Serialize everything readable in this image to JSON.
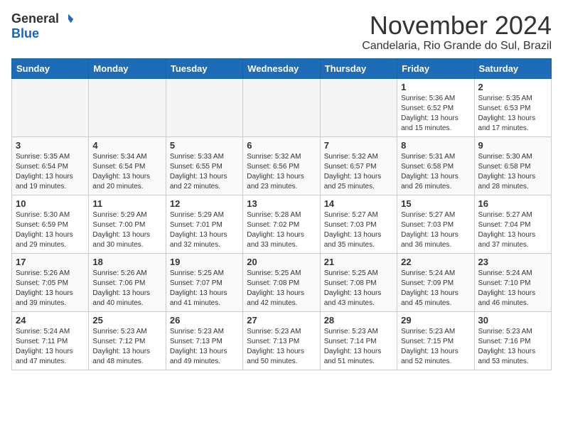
{
  "logo": {
    "general": "General",
    "blue": "Blue"
  },
  "header": {
    "month": "November 2024",
    "location": "Candelaria, Rio Grande do Sul, Brazil"
  },
  "weekdays": [
    "Sunday",
    "Monday",
    "Tuesday",
    "Wednesday",
    "Thursday",
    "Friday",
    "Saturday"
  ],
  "weeks": [
    [
      {
        "day": "",
        "info": ""
      },
      {
        "day": "",
        "info": ""
      },
      {
        "day": "",
        "info": ""
      },
      {
        "day": "",
        "info": ""
      },
      {
        "day": "",
        "info": ""
      },
      {
        "day": "1",
        "info": "Sunrise: 5:36 AM\nSunset: 6:52 PM\nDaylight: 13 hours and 15 minutes."
      },
      {
        "day": "2",
        "info": "Sunrise: 5:35 AM\nSunset: 6:53 PM\nDaylight: 13 hours and 17 minutes."
      }
    ],
    [
      {
        "day": "3",
        "info": "Sunrise: 5:35 AM\nSunset: 6:54 PM\nDaylight: 13 hours and 19 minutes."
      },
      {
        "day": "4",
        "info": "Sunrise: 5:34 AM\nSunset: 6:54 PM\nDaylight: 13 hours and 20 minutes."
      },
      {
        "day": "5",
        "info": "Sunrise: 5:33 AM\nSunset: 6:55 PM\nDaylight: 13 hours and 22 minutes."
      },
      {
        "day": "6",
        "info": "Sunrise: 5:32 AM\nSunset: 6:56 PM\nDaylight: 13 hours and 23 minutes."
      },
      {
        "day": "7",
        "info": "Sunrise: 5:32 AM\nSunset: 6:57 PM\nDaylight: 13 hours and 25 minutes."
      },
      {
        "day": "8",
        "info": "Sunrise: 5:31 AM\nSunset: 6:58 PM\nDaylight: 13 hours and 26 minutes."
      },
      {
        "day": "9",
        "info": "Sunrise: 5:30 AM\nSunset: 6:58 PM\nDaylight: 13 hours and 28 minutes."
      }
    ],
    [
      {
        "day": "10",
        "info": "Sunrise: 5:30 AM\nSunset: 6:59 PM\nDaylight: 13 hours and 29 minutes."
      },
      {
        "day": "11",
        "info": "Sunrise: 5:29 AM\nSunset: 7:00 PM\nDaylight: 13 hours and 30 minutes."
      },
      {
        "day": "12",
        "info": "Sunrise: 5:29 AM\nSunset: 7:01 PM\nDaylight: 13 hours and 32 minutes."
      },
      {
        "day": "13",
        "info": "Sunrise: 5:28 AM\nSunset: 7:02 PM\nDaylight: 13 hours and 33 minutes."
      },
      {
        "day": "14",
        "info": "Sunrise: 5:27 AM\nSunset: 7:03 PM\nDaylight: 13 hours and 35 minutes."
      },
      {
        "day": "15",
        "info": "Sunrise: 5:27 AM\nSunset: 7:03 PM\nDaylight: 13 hours and 36 minutes."
      },
      {
        "day": "16",
        "info": "Sunrise: 5:27 AM\nSunset: 7:04 PM\nDaylight: 13 hours and 37 minutes."
      }
    ],
    [
      {
        "day": "17",
        "info": "Sunrise: 5:26 AM\nSunset: 7:05 PM\nDaylight: 13 hours and 39 minutes."
      },
      {
        "day": "18",
        "info": "Sunrise: 5:26 AM\nSunset: 7:06 PM\nDaylight: 13 hours and 40 minutes."
      },
      {
        "day": "19",
        "info": "Sunrise: 5:25 AM\nSunset: 7:07 PM\nDaylight: 13 hours and 41 minutes."
      },
      {
        "day": "20",
        "info": "Sunrise: 5:25 AM\nSunset: 7:08 PM\nDaylight: 13 hours and 42 minutes."
      },
      {
        "day": "21",
        "info": "Sunrise: 5:25 AM\nSunset: 7:08 PM\nDaylight: 13 hours and 43 minutes."
      },
      {
        "day": "22",
        "info": "Sunrise: 5:24 AM\nSunset: 7:09 PM\nDaylight: 13 hours and 45 minutes."
      },
      {
        "day": "23",
        "info": "Sunrise: 5:24 AM\nSunset: 7:10 PM\nDaylight: 13 hours and 46 minutes."
      }
    ],
    [
      {
        "day": "24",
        "info": "Sunrise: 5:24 AM\nSunset: 7:11 PM\nDaylight: 13 hours and 47 minutes."
      },
      {
        "day": "25",
        "info": "Sunrise: 5:23 AM\nSunset: 7:12 PM\nDaylight: 13 hours and 48 minutes."
      },
      {
        "day": "26",
        "info": "Sunrise: 5:23 AM\nSunset: 7:13 PM\nDaylight: 13 hours and 49 minutes."
      },
      {
        "day": "27",
        "info": "Sunrise: 5:23 AM\nSunset: 7:13 PM\nDaylight: 13 hours and 50 minutes."
      },
      {
        "day": "28",
        "info": "Sunrise: 5:23 AM\nSunset: 7:14 PM\nDaylight: 13 hours and 51 minutes."
      },
      {
        "day": "29",
        "info": "Sunrise: 5:23 AM\nSunset: 7:15 PM\nDaylight: 13 hours and 52 minutes."
      },
      {
        "day": "30",
        "info": "Sunrise: 5:23 AM\nSunset: 7:16 PM\nDaylight: 13 hours and 53 minutes."
      }
    ]
  ]
}
